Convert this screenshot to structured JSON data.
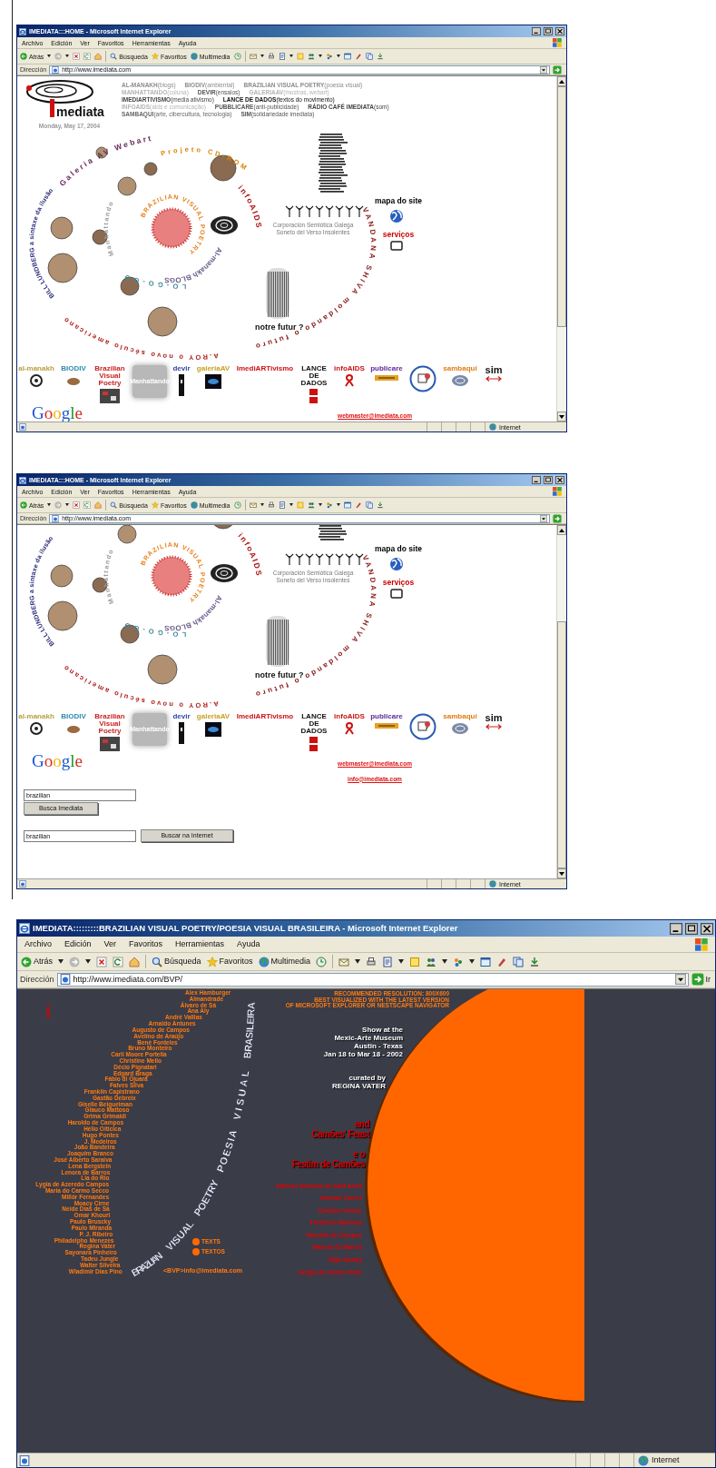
{
  "windows": [
    {
      "kind": "home",
      "title": "IMEDIATA:::HOME - Microsoft Internet Explorer",
      "menu": [
        "Archivo",
        "Edición",
        "Ver",
        "Favoritos",
        "Herramientas",
        "Ayuda"
      ],
      "toolbar": [
        "Atrás",
        "Búsqueda",
        "Favoritos",
        "Multimedia"
      ],
      "address": {
        "label": "Dirección",
        "url": "http://www.imediata.com"
      },
      "status": "Internet",
      "page": {
        "logo": "mediata",
        "date": "Monday, May 17, 2004",
        "nav_rows": [
          [
            {
              "text": "**AL-MANAKH**(blogs)",
              "color": "#8c8c8c"
            },
            {
              "text": "**BIODIV**(ambiental)",
              "color": "#8c8c8c"
            },
            {
              "text": "**BRAZILIAN VISUAL POETRY**(poesia visual)",
              "color": "#8c8c8c"
            }
          ],
          [
            {
              "text": "**MANHATTANDO**(coluna)",
              "color": "#b4b4b4"
            },
            {
              "text": "**DEVIR**(ensaios)",
              "color": "#555555"
            },
            {
              "text": "**GALERIAAV**(mostras, webart)",
              "color": "#b4b4b4"
            }
          ],
          [
            {
              "text": "**IMEDIARTIVISMO**(media ativismo)",
              "color": "#444444"
            },
            {
              "text": "**LANCE DE DADOS**(textos do movimento)",
              "color": "#111111"
            }
          ],
          [
            {
              "text": "**INFOAIDS**(aids e comunicação)",
              "color": "#b4b4b4"
            },
            {
              "text": "**PUBBLICARE**(anti-publicidade)",
              "color": "#555555"
            },
            {
              "text": "**RÁDIO CAFÉ IMEDIATA**(som)",
              "color": "#444444"
            }
          ],
          [
            {
              "text": "**SAMBAQUI**(arte, cibercultura, tecnologia)",
              "color": "#666666"
            },
            {
              "text": "**SIM**(solidariedade imediata)",
              "color": "#555555"
            }
          ]
        ],
        "spiral": [
          {
            "text": "Galeria AV Webart",
            "color": "#6a2a5a"
          },
          {
            "text": "Projeto CD-ROM",
            "color": "#d8860a"
          },
          {
            "text": "infoAIDS",
            "color": "#b01010"
          },
          {
            "text": "Manhattando",
            "color": "#9a9a9a"
          },
          {
            "text": "BRAZILIAN VISUAL POETRY",
            "color": "#e8801a"
          },
          {
            "text": "Al-manakh BLOGS",
            "color": "#6a5a8a"
          },
          {
            "text": "LO-GO-GO",
            "color": "#3a8aa0"
          },
          {
            "text": "BILL LUNDBERG a sintaxe da ilusão",
            "color": "#2a2a7a"
          },
          {
            "text": "VANDANA SHIVA moldando o futuro",
            "color": "#8a1a1a"
          },
          {
            "text": "A.ROY o novo século americano",
            "color": "#b02020"
          }
        ],
        "caption": [
          "Corporación Semiótica Galega",
          "Soneto del Verso Insolentes"
        ],
        "site_links": [
          {
            "text": "mapa do site",
            "color": "#000000"
          },
          {
            "text": "serviços",
            "color": "#cc0000"
          }
        ],
        "notre": "notre futur ?",
        "sections": [
          {
            "kind": "logo",
            "label": "al-manakh",
            "color": "#b8a040"
          },
          {
            "kind": "logo",
            "label": "BIODIV",
            "color": "#2a8ab0"
          },
          {
            "kind": "logo",
            "label": "Brazilian Visual Poetry",
            "color": "#cc2222"
          },
          {
            "kind": "plaque",
            "label": "Manhattando",
            "color": "#ffffff"
          },
          {
            "kind": "logo",
            "label": "devir",
            "color": "#3344aa"
          },
          {
            "kind": "logo",
            "label": "galeriaAV",
            "color": "#c8a020"
          },
          {
            "kind": "logo",
            "label": "ImediARTivismo",
            "color": "#cc1111"
          },
          {
            "kind": "logo",
            "label": "LANCE DE DADOS",
            "color": "#111111"
          },
          {
            "kind": "logo",
            "label": "infoAIDS",
            "color": "#cc1111"
          },
          {
            "kind": "logo",
            "label": "publicare",
            "color": "#5a2a9a"
          },
          {
            "kind": "emblem"
          },
          {
            "kind": "logo",
            "label": "sambaqui",
            "color": "#e07b10"
          },
          {
            "kind": "logo",
            "label": "sim",
            "color": "#111111"
          }
        ],
        "google": "Google",
        "emails": [
          "webmaster@imediata.com"
        ]
      }
    },
    {
      "kind": "home",
      "title": "IMEDIATA:::HOME - Microsoft Internet Explorer",
      "menu": [
        "Archivo",
        "Edición",
        "Ver",
        "Favoritos",
        "Herramientas",
        "Ayuda"
      ],
      "toolbar": [
        "Atrás",
        "Búsqueda",
        "Favoritos",
        "Multimedia"
      ],
      "address": {
        "label": "Dirección",
        "url": "http://www.imediata.com"
      },
      "status": "Internet",
      "page": {
        "spiral": [
          {
            "text": "infoAIDS",
            "color": "#b01010"
          },
          {
            "text": "Manhattando",
            "color": "#9a9a9a"
          },
          {
            "text": "BRAZILIAN VISUAL POETRY",
            "color": "#e8801a"
          },
          {
            "text": "Al-manakh BLOGS",
            "color": "#6a5a8a"
          },
          {
            "text": "LO-GO-GO",
            "color": "#3a8aa0"
          },
          {
            "text": "BILL LUNDBERG a sintaxe da ilusão",
            "color": "#2a2a7a"
          },
          {
            "text": "VANDANA SHIVA moldando o futuro",
            "color": "#8a1a1a"
          },
          {
            "text": "A.ROY o novo século americano",
            "color": "#b02020"
          }
        ],
        "caption": [
          "Corporación Semiótica Galega",
          "Soneto del Verso Insolentes"
        ],
        "site_links": [
          {
            "text": "mapa do site",
            "color": "#000000"
          },
          {
            "text": "serviços",
            "color": "#cc0000"
          }
        ],
        "notre": "notre futur ?",
        "sections": [
          {
            "kind": "logo",
            "label": "al-manakh",
            "color": "#b8a040"
          },
          {
            "kind": "logo",
            "label": "BIODIV",
            "color": "#2a8ab0"
          },
          {
            "kind": "logo",
            "label": "Brazilian Visual Poetry",
            "color": "#cc2222"
          },
          {
            "kind": "plaque",
            "label": "Manhattando",
            "color": "#ffffff"
          },
          {
            "kind": "logo",
            "label": "devir",
            "color": "#3344aa"
          },
          {
            "kind": "logo",
            "label": "galeriaAV",
            "color": "#c8a020"
          },
          {
            "kind": "logo",
            "label": "ImediARTivismo",
            "color": "#cc1111"
          },
          {
            "kind": "logo",
            "label": "LANCE DE DADOS",
            "color": "#111111"
          },
          {
            "kind": "logo",
            "label": "infoAIDS",
            "color": "#cc1111"
          },
          {
            "kind": "logo",
            "label": "publicare",
            "color": "#5a2a9a"
          },
          {
            "kind": "emblem"
          },
          {
            "kind": "logo",
            "label": "sambaqui",
            "color": "#e07b10"
          },
          {
            "kind": "logo",
            "label": "sim",
            "color": "#111111"
          }
        ],
        "google": "Google",
        "emails": [
          "webmaster@imediata.com",
          "info@imediata.com"
        ],
        "searches": [
          {
            "kind": "stacked",
            "value": "brazilian",
            "button": "Busca Imediata"
          },
          {
            "kind": "inline",
            "value": "brazilian",
            "button": "Buscar na Internet"
          }
        ]
      }
    },
    {
      "kind": "bvp",
      "title": "IMEDIATA:::::::::BRAZILIAN VISUAL POETRY/POESIA VISUAL BRASILEIRA - Microsoft Internet Explorer",
      "menu": [
        "Archivo",
        "Edición",
        "Ver",
        "Favoritos",
        "Herramientas",
        "Ayuda"
      ],
      "toolbar": [
        "Atrás",
        "Búsqueda",
        "Favoritos",
        "Multimedia"
      ],
      "address": {
        "label": "Dirección",
        "url": "http://www.imediata.com/BVP/",
        "go": "Ir"
      },
      "status": "Internet",
      "page": {
        "logo": "i",
        "names": [
          "Alex Hamburger",
          "Almandrade",
          "Álvaro de Sá",
          "Ana Aly",
          "André Vallias",
          "Arnaldo Antunes",
          "Augusto de Campos",
          "Avelino de Araújo",
          "Bené Fonteles",
          "Bruno Monteiro",
          "Carli Moore Portella",
          "Christine Mello",
          "Décio Pignatari",
          "Edgard Braga",
          "Fábio di Ojuara",
          "Falves Silva",
          "Franklin Capistrano",
          "Gastão Debreix",
          "Giselle Beiguelman",
          "Glauco Mattoso",
          "Grima Grimaldi",
          "Haroldo de Campos",
          "Hélio Oiticica",
          "Hugo Pontes",
          "J. Medeiros",
          "João Bandeira",
          "Joaquim Branco",
          "José Alberto Saraiva",
          "Lena Bergstein",
          "Lenora de Barros",
          "Lia do Rio",
          "Lygia de Azeredo Campos",
          "Maria do Carmo Secco",
          "Millôr Fernandes",
          "Moacy Cirne",
          "Neide Dias de Sá",
          "Omar Khouri",
          "Paulo Bruscky",
          "Paulo Miranda",
          "P. J. Ribeiro",
          "Philadelpho Menezes",
          "Regina Vater",
          "Sayonara Pinheiro",
          "Tadeu Jungle",
          "Walter Silveira",
          "Wladimir Dias Pino"
        ],
        "arc_title": [
          "BRAZILIAN",
          "VISUAL",
          "POETRY",
          "POESIA",
          "VISUAL",
          "BRASILEIRA"
        ],
        "notice": [
          "RECOMMENDED RESOLUTION: 800X600",
          "BEST VISUALIZED WITH THE LATEST VERSION",
          "OF MICROSOFT EXPLORER  OR NESTSCAPE NAVIGATOR"
        ],
        "show": [
          "Show  at the",
          "Mexic-Arte Museum",
          "Austin - Texas",
          "Jan 18 to Mar 18 - 2002"
        ],
        "curator": [
          "curated by",
          "REGINA VATER"
        ],
        "feasts": [
          [
            "and",
            "Camões' Feast"
          ],
          [
            "e o",
            "Festim de Camões"
          ]
        ],
        "poets": [
          "Affonso Romano de Sant'Anna",
          "Antonio Cícero",
          "Caetano Veloso",
          "Frederico Barbosa",
          "Haroldo de Campos",
          "Manoel de Barros",
          "Olga Savary",
          "Sérgio de Castro Pinto"
        ],
        "links": [
          "TEXTS",
          "TEXTOS"
        ],
        "contact": "<BVP>info@imediata.com"
      }
    }
  ]
}
